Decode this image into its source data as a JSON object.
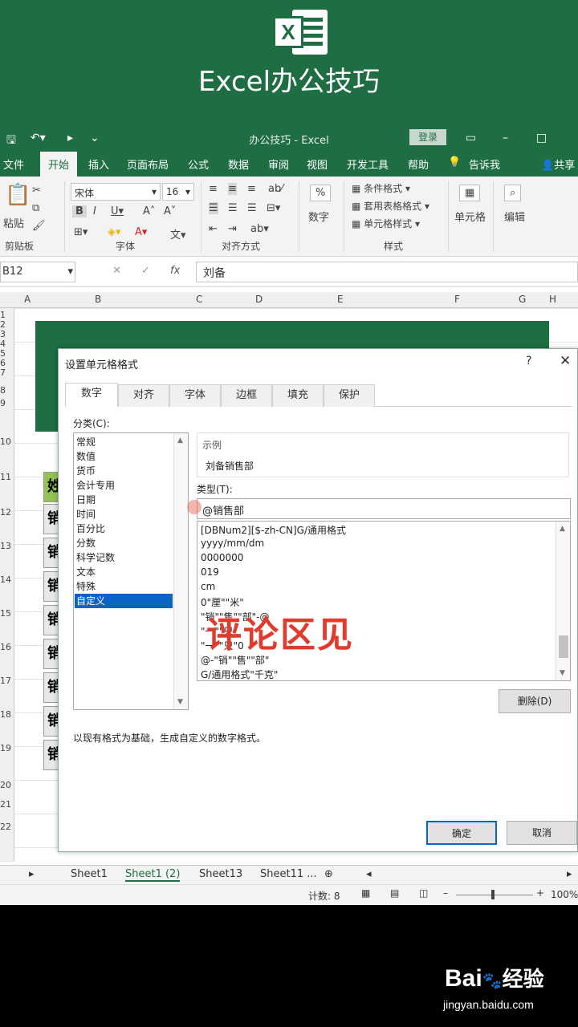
{
  "banner": {
    "logo_letter": "X",
    "title": "Excel办公技巧"
  },
  "titlebar": {
    "doc_title": "办公技巧 - Excel",
    "login": "登录"
  },
  "ribbon_tabs": [
    "文件",
    "开始",
    "插入",
    "页面布局",
    "公式",
    "数据",
    "审阅",
    "视图",
    "开发工具",
    "帮助",
    "告诉我",
    "共享"
  ],
  "ribbon": {
    "paste": "粘贴",
    "clipboard": "剪贴板",
    "font_name": "宋体",
    "font_size": "16",
    "font_group": "字体",
    "align_group": "对齐方式",
    "number": "数字",
    "cond_format": "条件格式",
    "table_format": "套用表格格式",
    "cell_style": "单元格样式",
    "styles_group": "样式",
    "cells": "单元格",
    "edit": "编辑"
  },
  "formula_bar": {
    "name_box": "B12",
    "value": "刘备"
  },
  "columns": [
    "A",
    "B",
    "C",
    "D",
    "E",
    "F",
    "G",
    "H"
  ],
  "rows": [
    "1",
    "2",
    "3",
    "4",
    "5",
    "6",
    "7",
    "8",
    "9",
    "10",
    "11",
    "12",
    "13",
    "14",
    "15",
    "16",
    "17",
    "18",
    "19",
    "20",
    "21",
    "22"
  ],
  "cell_b_chars": [
    "姓",
    "销",
    "销",
    "销",
    "销",
    "销",
    "销",
    "销",
    "销"
  ],
  "sheets": [
    "Sheet1",
    "Sheet1 (2)",
    "Sheet13",
    "Sheet11 ..."
  ],
  "status": {
    "count": "计数: 8",
    "zoom": "100%"
  },
  "dialog": {
    "title": "设置单元格格式",
    "help": "?",
    "close": "✕",
    "tabs": [
      "数字",
      "对齐",
      "字体",
      "边框",
      "填充",
      "保护"
    ],
    "category_label": "分类(C):",
    "categories": [
      "常规",
      "数值",
      "货币",
      "会计专用",
      "日期",
      "时间",
      "百分比",
      "分数",
      "科学记数",
      "文本",
      "特殊",
      "自定义"
    ],
    "selected_category": "自定义",
    "sample_label": "示例",
    "sample_value": "刘备销售部",
    "type_label": "类型(T):",
    "type_value": "@销售部",
    "type_list": [
      "[DBNum2][$-zh-CN]G/通用格式",
      "yyyy/mm/dm",
      "0000000",
      "019",
      "cm",
      "0\"厘\"\"米\"",
      "\"销\"\"售\"\"部\"-@",
      "\"一\"\"只\"",
      "\"一\"\"只\"0",
      "@-\"销\"\"售\"\"部\"",
      "G/通用格式\"千克\""
    ],
    "overlay_text": "评论区见",
    "delete_btn": "删除(D)",
    "description": "以现有格式为基础，生成自定义的数字格式。",
    "ok": "确定",
    "cancel": "取消"
  },
  "watermark": {
    "brand": "Bai",
    "brand2": "经验",
    "url": "jingyan.baidu.com"
  }
}
